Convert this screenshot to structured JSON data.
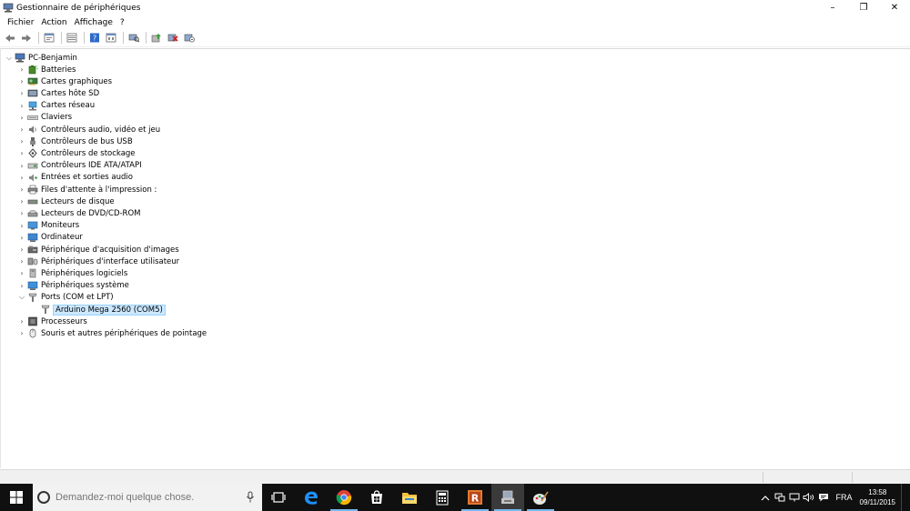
{
  "window": {
    "title": "Gestionnaire de périphériques",
    "controls": {
      "minimize": "–",
      "maximize": "❐",
      "close": "✕"
    }
  },
  "menu": [
    "Fichier",
    "Action",
    "Affichage",
    "?"
  ],
  "toolbar": {
    "buttons": [
      "back-arrow",
      "forward-arrow",
      "properties-sheet",
      "show-hide-tree",
      "help",
      "view-resources",
      "scan-hardware",
      "update-driver",
      "disable-device",
      "uninstall-device"
    ]
  },
  "tree": {
    "root": "PC-Benjamin",
    "nodes": [
      {
        "label": "Batteries",
        "icon": "battery-icon",
        "expanded": false
      },
      {
        "label": "Cartes graphiques",
        "icon": "graphics-card-icon",
        "expanded": false
      },
      {
        "label": "Cartes hôte SD",
        "icon": "sd-host-icon",
        "expanded": false
      },
      {
        "label": "Cartes réseau",
        "icon": "network-adapter-icon",
        "expanded": false
      },
      {
        "label": "Claviers",
        "icon": "keyboard-icon",
        "expanded": false
      },
      {
        "label": "Contrôleurs audio, vidéo et jeu",
        "icon": "speaker-icon",
        "expanded": false
      },
      {
        "label": "Contrôleurs de bus USB",
        "icon": "usb-icon",
        "expanded": false
      },
      {
        "label": "Contrôleurs de stockage",
        "icon": "storage-controller-icon",
        "expanded": false
      },
      {
        "label": "Contrôleurs IDE ATA/ATAPI",
        "icon": "ide-controller-icon",
        "expanded": false
      },
      {
        "label": "Entrées et sorties audio",
        "icon": "audio-io-icon",
        "expanded": false
      },
      {
        "label": "Files d'attente à l'impression :",
        "icon": "printer-icon",
        "expanded": false
      },
      {
        "label": "Lecteurs de disque",
        "icon": "disk-drive-icon",
        "expanded": false
      },
      {
        "label": "Lecteurs de DVD/CD-ROM",
        "icon": "dvd-drive-icon",
        "expanded": false
      },
      {
        "label": "Moniteurs",
        "icon": "monitor-icon",
        "expanded": false
      },
      {
        "label": "Ordinateur",
        "icon": "computer-icon",
        "expanded": false
      },
      {
        "label": "Périphérique d'acquisition d'images",
        "icon": "camera-icon",
        "expanded": false
      },
      {
        "label": "Périphériques d'interface utilisateur",
        "icon": "hid-icon",
        "expanded": false
      },
      {
        "label": "Périphériques logiciels",
        "icon": "software-device-icon",
        "expanded": false
      },
      {
        "label": "Périphériques système",
        "icon": "system-device-icon",
        "expanded": false
      },
      {
        "label": "Ports (COM et LPT)",
        "icon": "port-icon",
        "expanded": true
      },
      {
        "label": "Arduino Mega 2560 (COM5)",
        "icon": "port-icon",
        "child": true,
        "selected": true
      },
      {
        "label": "Processeurs",
        "icon": "processor-icon",
        "expanded": false
      },
      {
        "label": "Souris et autres périphériques de pointage",
        "icon": "mouse-icon",
        "expanded": false
      }
    ]
  },
  "taskbar": {
    "search_placeholder": "Demandez-moi quelque chose.",
    "apps": [
      "task-view-icon",
      "edge-icon",
      "chrome-icon",
      "store-icon",
      "file-explorer-icon",
      "calculator-icon",
      "r-app-icon",
      "device-manager-icon",
      "paint-icon"
    ],
    "tray": {
      "language": "FRA",
      "time": "13:58",
      "date": "09/11/2015"
    }
  },
  "colors": {
    "selection": "#cce8ff",
    "taskbar": "#101010",
    "accent": "#76b9ed"
  }
}
